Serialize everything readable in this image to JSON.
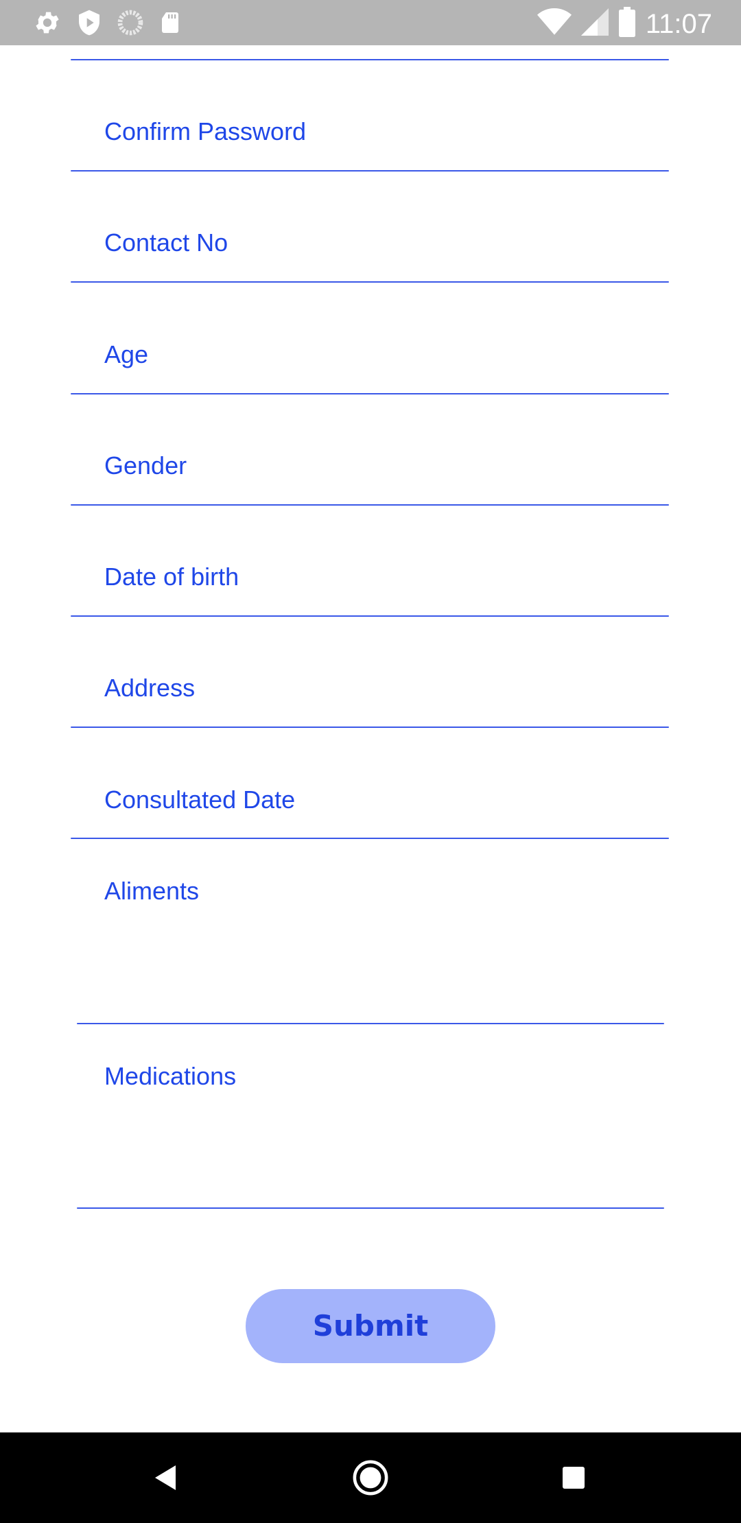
{
  "status_bar": {
    "time": "11:07",
    "left_icons": [
      "settings-icon",
      "shield-play-icon",
      "loading-circle-icon",
      "sd-card-icon"
    ],
    "right_icons": [
      "wifi-icon",
      "cell-signal-icon",
      "battery-icon"
    ]
  },
  "form": {
    "fields": [
      {
        "label": "Confirm Password"
      },
      {
        "label": "Contact No"
      },
      {
        "label": "Age"
      },
      {
        "label": "Gender"
      },
      {
        "label": "Date of birth"
      },
      {
        "label": "Address"
      },
      {
        "label": "Consultated Date"
      },
      {
        "label": "Aliments"
      },
      {
        "label": "Medications"
      }
    ],
    "submit_label": "Submit"
  },
  "colors": {
    "accent": "#1f47e8",
    "button_bg": "#a3b3fb",
    "status_bar": "#b5b5b5",
    "nav_bar": "#000000"
  },
  "nav_bar": {
    "icons": [
      "back-icon",
      "home-icon",
      "recents-icon"
    ]
  }
}
